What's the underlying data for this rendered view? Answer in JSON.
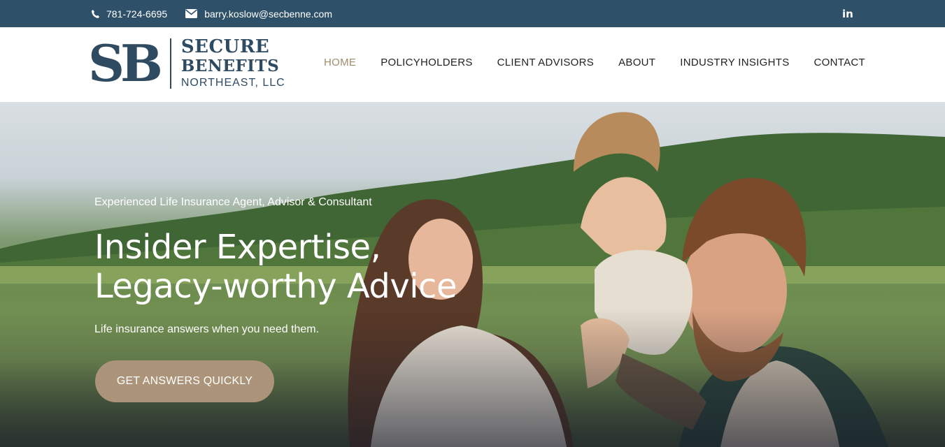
{
  "topbar": {
    "phone": "781-724-6695",
    "email": "barry.koslow@secbenne.com",
    "social_icon": "linkedin-icon",
    "social_label": "in"
  },
  "logo": {
    "monogram": "SB",
    "line1": "SECURE",
    "line2": "BENEFITS",
    "line3": "NORTHEAST, LLC"
  },
  "nav": {
    "items": [
      {
        "label": "HOME",
        "active": true
      },
      {
        "label": "POLICYHOLDERS"
      },
      {
        "label": "CLIENT ADVISORS"
      },
      {
        "label": "ABOUT"
      },
      {
        "label": "INDUSTRY INSIGHTS"
      },
      {
        "label": "CONTACT"
      }
    ]
  },
  "hero": {
    "eyebrow": "Experienced Life Insurance Agent, Advisor & Consultant",
    "headline_line1": "Insider Expertise,",
    "headline_line2": "Legacy-worthy Advice",
    "subtext": "Life insurance answers when you need them.",
    "cta_label": "GET ANSWERS QUICKLY"
  },
  "colors": {
    "topbar_bg": "#2e5068",
    "brand_navy": "#2e4b62",
    "nav_active": "#a08a6c",
    "cta_bg": "#ab9479"
  }
}
